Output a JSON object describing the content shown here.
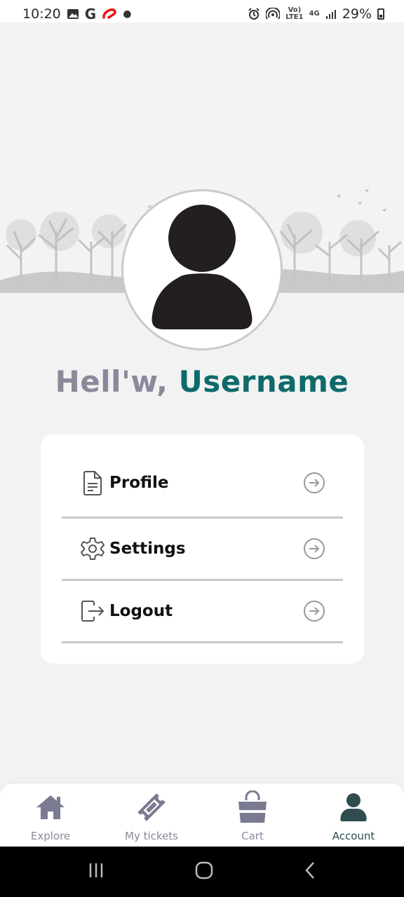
{
  "status_bar": {
    "time": "10:20",
    "network_label_top": "Vo)",
    "network_label_bottom": "LTE1",
    "signal_label": "4G",
    "battery_percent": "29%"
  },
  "greeting": {
    "hello": "Hell'w, ",
    "username": "Username"
  },
  "menu": {
    "items": [
      {
        "label": "Profile",
        "icon": "document-icon"
      },
      {
        "label": "Settings",
        "icon": "gear-icon"
      },
      {
        "label": "Logout",
        "icon": "logout-icon"
      }
    ]
  },
  "bottom_nav": {
    "items": [
      {
        "label": "Explore",
        "icon": "home-icon"
      },
      {
        "label": "My tickets",
        "icon": "ticket-icon"
      },
      {
        "label": "Cart",
        "icon": "shopping-bag-icon"
      },
      {
        "label": "Account",
        "icon": "user-icon",
        "active": true
      }
    ]
  },
  "colors": {
    "accent": "#0f6a6b",
    "greeting_gray": "#8a8a9c",
    "nav_inactive": "#8a8a9a",
    "nav_active": "#2f4d4f"
  }
}
